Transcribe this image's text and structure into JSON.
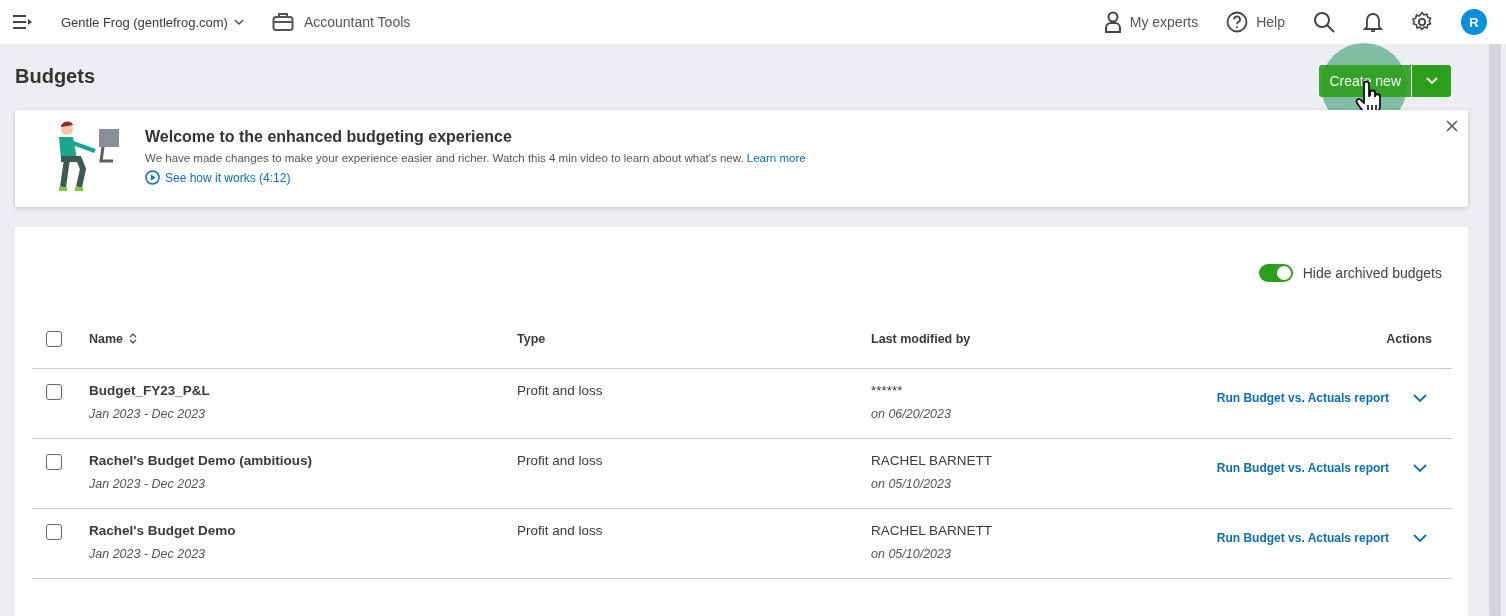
{
  "top_bar": {
    "company": "Gentle Frog (gentlefrog.com)",
    "accountant_tools": "Accountant Tools",
    "my_experts": "My experts",
    "help": "Help",
    "avatar": "R"
  },
  "page": {
    "title": "Budgets",
    "create_button": "Create new"
  },
  "banner": {
    "title": "Welcome to the enhanced budgeting experience",
    "text": "We have made changes to make your experience easier and richer. Watch this 4 min video to learn about what's new.",
    "link": "Learn more",
    "video_link": "See how it works (4:12)"
  },
  "archived_toggle": {
    "label": "Hide archived budgets",
    "on": true
  },
  "table": {
    "select_all_checked": false,
    "columns": [
      "Name",
      "Type",
      "Last modified by",
      "Actions"
    ],
    "rows": [
      {
        "name": "Budget_FY23_P&L",
        "period": "Jan 2023 - Dec 2023",
        "type": "Profit and loss",
        "modified_by": "******",
        "modified_on": "on 06/20/2023",
        "action": "Run Budget vs. Actuals report",
        "checked": false
      },
      {
        "name": "Rachel's Budget Demo (ambitious)",
        "period": "Jan 2023 - Dec 2023",
        "type": "Profit and loss",
        "modified_by": "RACHEL BARNETT",
        "modified_on": "on 05/10/2023",
        "action": "Run Budget vs. Actuals report",
        "checked": false
      },
      {
        "name": "Rachel's Budget Demo",
        "period": "Jan 2023 - Dec 2023",
        "type": "Profit and loss",
        "modified_by": "RACHEL BARNETT",
        "modified_on": "on 05/10/2023",
        "action": "Run Budget vs. Actuals report",
        "checked": false
      }
    ]
  }
}
